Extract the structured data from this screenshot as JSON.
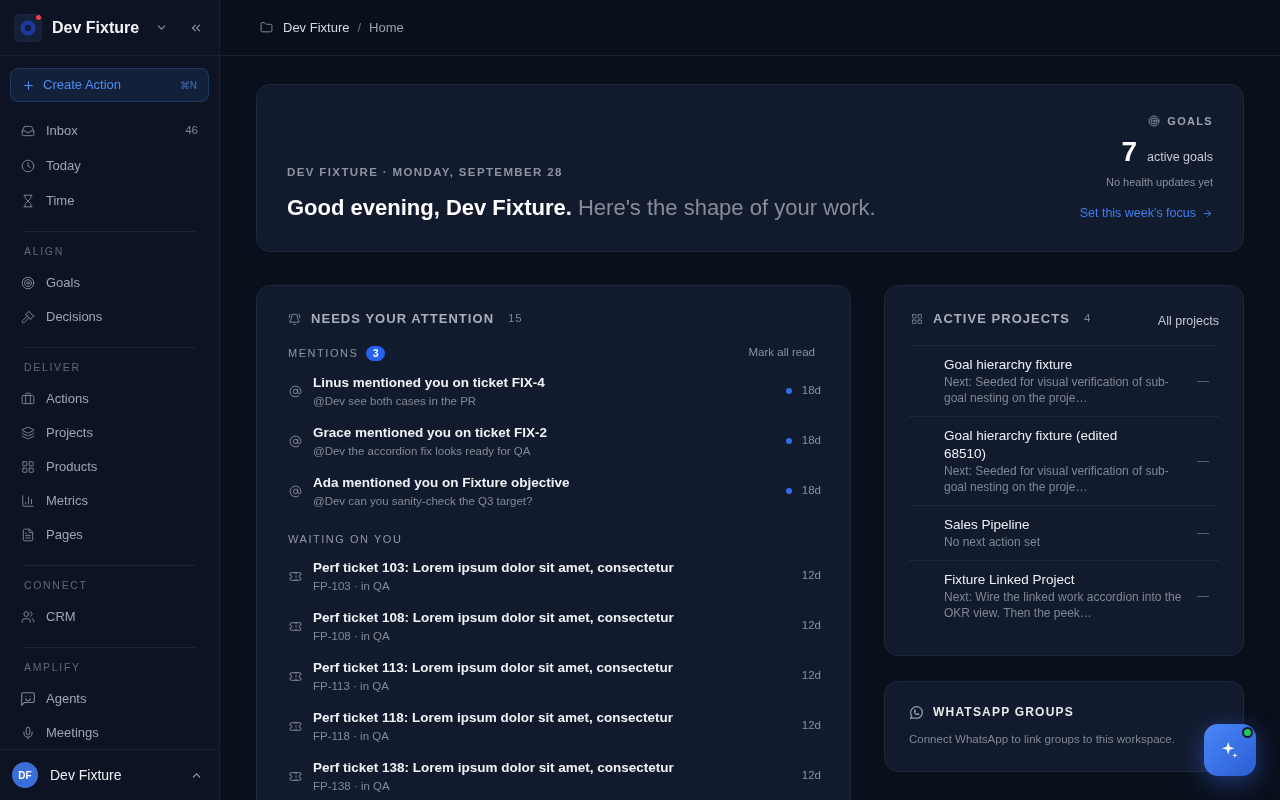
{
  "sidebar": {
    "workspace": {
      "name": "Dev Fixture",
      "alert": true
    },
    "create_button": {
      "label": "Create Action",
      "shortcut": "⌘N"
    },
    "sections": [
      {
        "items": [
          {
            "label": "Inbox",
            "count": "46",
            "selected": false
          },
          {
            "label": "Today",
            "selected": false
          },
          {
            "label": "Time",
            "selected": false
          }
        ]
      },
      {
        "heading": "ALIGN",
        "items": [
          {
            "label": "Goals",
            "selected": false
          },
          {
            "label": "Decisions",
            "selected": false
          }
        ]
      },
      {
        "heading": "DELIVER",
        "items": [
          {
            "label": "Actions",
            "selected": false
          },
          {
            "label": "Projects",
            "selected": false
          },
          {
            "label": "Products",
            "selected": false
          },
          {
            "label": "Metrics",
            "selected": false
          },
          {
            "label": "Pages",
            "selected": false
          }
        ]
      },
      {
        "heading": "CONNECT",
        "items": [
          {
            "label": "CRM",
            "selected": false
          }
        ]
      },
      {
        "heading": "AMPLIFY",
        "items": [
          {
            "label": "Agents",
            "selected": false
          },
          {
            "label": "Meetings",
            "selected": false
          }
        ]
      }
    ],
    "user": {
      "initials": "DF",
      "name": "Dev Fixture"
    }
  },
  "breadcrumb": {
    "items": [
      "Dev Fixture",
      "Home"
    ],
    "separator": "/"
  },
  "hero": {
    "dateline": "DEV FIXTURE · MONDAY, SEPTEMBER 28",
    "greeting": "**Good evening, Dev Fixture.** Here's the shape of your work.",
    "goals": {
      "label": "GOALS",
      "count": "7",
      "count_label": "active goals",
      "note": "No health updates yet",
      "link": "Set this week's focus"
    }
  },
  "attention": {
    "title": "NEEDS YOUR ATTENTION",
    "count": "15",
    "sections": [
      {
        "kind": "mentions",
        "title": "MENTIONS",
        "badge": "3",
        "action": "Mark all read",
        "items": [
          {
            "title": "Linus mentioned you on ticket FIX-4",
            "subtitle": "@Dev see both cases in the PR",
            "unread": true,
            "age": "18d"
          },
          {
            "title": "Grace mentioned you on ticket FIX-2",
            "subtitle": "@Dev the accordion fix looks ready for QA",
            "unread": true,
            "age": "18d"
          },
          {
            "title": "Ada mentioned you on Fixture objective",
            "subtitle": "@Dev can you sanity-check the Q3 target?",
            "unread": true,
            "age": "18d"
          }
        ]
      },
      {
        "kind": "waiting",
        "title": "WAITING ON YOU",
        "items": [
          {
            "title": "Perf ticket 103: Lorem ipsum dolor sit amet, consectetur",
            "subtitle": "FP-103 · in QA",
            "unread": false,
            "age": "12d"
          },
          {
            "title": "Perf ticket 108: Lorem ipsum dolor sit amet, consectetur",
            "subtitle": "FP-108 · in QA",
            "unread": false,
            "age": "12d"
          },
          {
            "title": "Perf ticket 113: Lorem ipsum dolor sit amet, consectetur",
            "subtitle": "FP-113 · in QA",
            "unread": false,
            "age": "12d"
          },
          {
            "title": "Perf ticket 118: Lorem ipsum dolor sit amet, consectetur",
            "subtitle": "FP-118 · in QA",
            "unread": false,
            "age": "12d"
          },
          {
            "title": "Perf ticket 138: Lorem ipsum dolor sit amet, consectetur",
            "subtitle": "FP-138 · in QA",
            "unread": false,
            "age": "12d"
          }
        ]
      }
    ]
  },
  "projects": {
    "title": "ACTIVE PROJECTS",
    "count": "4",
    "link": "All projects",
    "rows": [
      {
        "name": "Goal hierarchy fixture",
        "next": "Next: Seeded for visual verification of sub-goal nesting on the proje…",
        "health": "—"
      },
      {
        "name": "Goal hierarchy fixture (edited 68510)",
        "next": "Next: Seeded for visual verification of sub-goal nesting on the proje…",
        "health": "—"
      },
      {
        "name": "Sales Pipeline",
        "next": "No next action set",
        "health": "—"
      },
      {
        "name": "Fixture Linked Project",
        "next": "Next: Wire the linked work accordion into the OKR view. Then the peek…",
        "health": "—"
      }
    ]
  },
  "whatsapp": {
    "title": "WHATSAPP GROUPS",
    "text": "Connect WhatsApp to link groups to this workspace."
  },
  "assistant_button": {
    "online": true
  }
}
